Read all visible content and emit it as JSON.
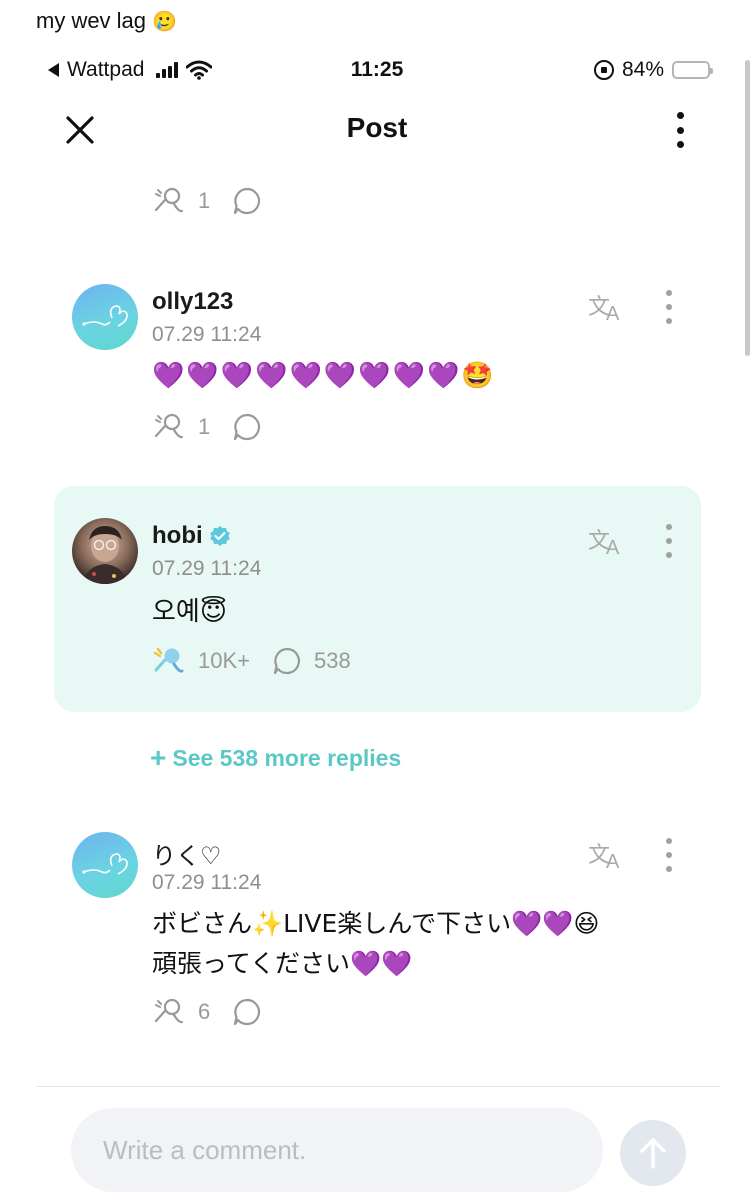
{
  "caption": {
    "text": "my wev lag",
    "emoji": "🥲"
  },
  "status_bar": {
    "back_app": "Wattpad",
    "time": "11:25",
    "battery_percent": "84%",
    "battery_level": 0.84
  },
  "nav": {
    "title": "Post"
  },
  "top_actions": {
    "likes": "1"
  },
  "comments": [
    {
      "username": "olly123",
      "timestamp": "07.29 11:24",
      "body": "💜💜💜💜💜💜💜💜💜🤩",
      "likes": "1",
      "replies": ""
    },
    {
      "username": "hobi",
      "verified": true,
      "timestamp": "07.29 11:24",
      "body": "오예😇",
      "likes": "10K+",
      "replies": "538"
    },
    {
      "username": "りく♡",
      "timestamp": "07.29 11:24",
      "body_line1": "ボビさん✨LIVE楽しんで下さい💜💜😆",
      "body_line2": "頑張ってください💜💜",
      "likes": "6",
      "replies": ""
    }
  ],
  "see_more": {
    "label": "See 538 more replies"
  },
  "composer": {
    "placeholder": "Write a comment."
  },
  "colors": {
    "accent": "#5bc8c6",
    "highlight_bg": "#e8f8f4",
    "battery": "#f4c414"
  }
}
